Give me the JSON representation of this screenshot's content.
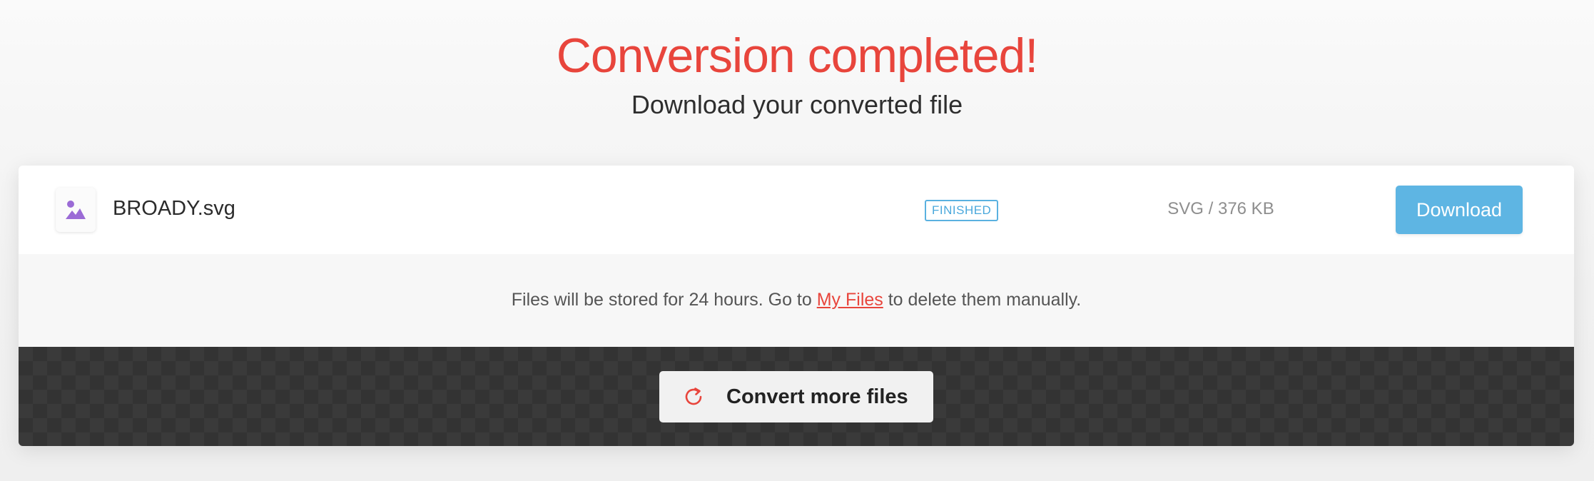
{
  "header": {
    "title": "Conversion completed!",
    "subtitle": "Download your converted file"
  },
  "file": {
    "icon": "image-icon",
    "name": "BROADY.svg",
    "status": "FINISHED",
    "size": "SVG / 376 KB",
    "download_label": "Download"
  },
  "notice": {
    "prefix": "Files will be stored for 24 hours. Go to ",
    "link_label": "My Files",
    "suffix": " to delete them manually."
  },
  "actions": {
    "convert_more_label": "Convert more files",
    "convert_more_icon": "refresh-icon"
  },
  "colors": {
    "accent_red": "#e8453c",
    "download_blue": "#5eb5e3",
    "status_blue": "#4aa8dc",
    "file_icon_purple": "#9b6bd6"
  }
}
